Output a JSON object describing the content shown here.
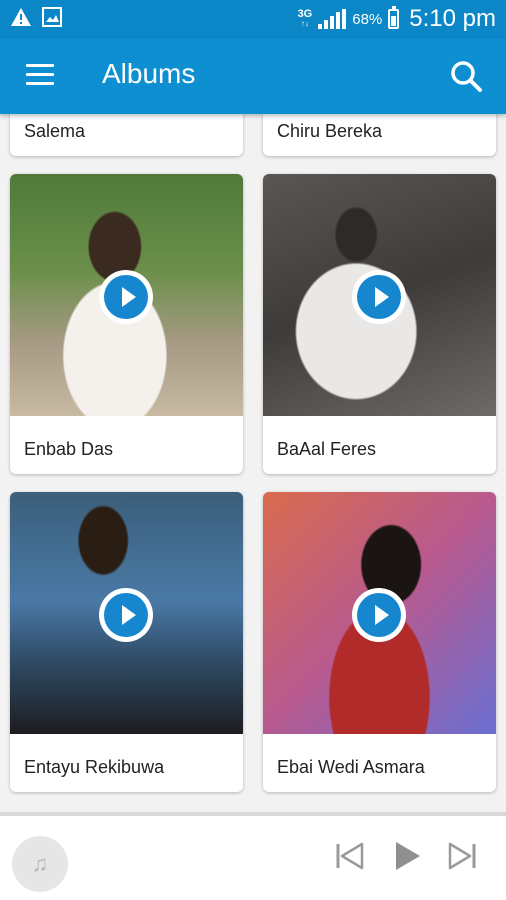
{
  "status_bar": {
    "network": "3G",
    "network_sub": "↑↓",
    "battery": "68%",
    "time": "5:10 pm"
  },
  "app_bar": {
    "title": "Albums"
  },
  "albums": [
    {
      "title": "Salema"
    },
    {
      "title": "Chiru Bereka"
    },
    {
      "title": "Enbab Das"
    },
    {
      "title": "BaAal Feres"
    },
    {
      "title": "Entayu Rekibuwa"
    },
    {
      "title": "Ebai Wedi Asmara"
    }
  ],
  "player": {
    "album_art_icon": "music-note-icon",
    "controls": [
      "skip-previous-icon",
      "play-icon",
      "skip-next-icon"
    ]
  },
  "colors": {
    "primary": "#0d8fd1",
    "status_bar": "#0b87c8",
    "play_button": "#1687cf"
  }
}
